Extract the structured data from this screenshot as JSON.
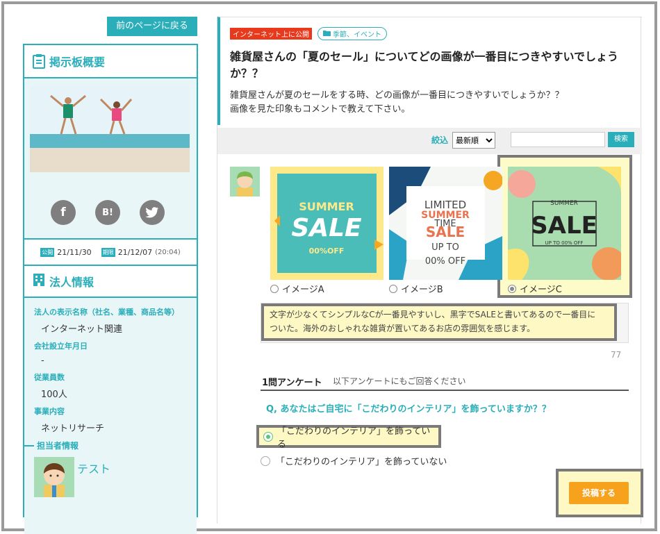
{
  "sidebar": {
    "back_button": "前のページに戻る",
    "board_title": "掲示板概要",
    "social": {
      "facebook": "f",
      "hatena": "B!",
      "twitter": "twitter"
    },
    "dates": {
      "public_tag": "公開",
      "public_date": "21/11/30",
      "deadline_tag": "期限",
      "deadline_date": "21/12/07",
      "deadline_time": "(20:04)"
    },
    "corp_title": "法人情報",
    "fields": [
      {
        "label": "法人の表示名称（社名、業種、商品名等）",
        "value": "インターネット関連"
      },
      {
        "label": "会社設立年月日",
        "value": "-"
      },
      {
        "label": "従業員数",
        "value": "100人"
      },
      {
        "label": "事業内容",
        "value": "ネットリサーチ"
      }
    ],
    "staff_title": "担当者情報",
    "staff_name": "テスト"
  },
  "post": {
    "scope_badge": "インターネット上に公開",
    "category": "季節、イベント",
    "title": "雑貨屋さんの「夏のセール」についてどの画像が一番目につきやすいでしょうか？？",
    "desc_line1": "雑貨屋さんが夏のセールをする時、どの画像が一番目につきやすいでしょうか？？",
    "desc_line2": "画像を見た印象もコメントで教えて下さい。"
  },
  "filter": {
    "label": "絞込",
    "sort_selected": "最新順",
    "search_placeholder": "",
    "search_button": "検索"
  },
  "options": [
    {
      "label": "イメージA",
      "image_text_1": "SUMMER",
      "image_text_2": "SALE",
      "image_text_3": "00%OFF",
      "selected": false
    },
    {
      "label": "イメージB",
      "image_text_1": "LIMITED",
      "image_text_2": "SUMMER",
      "image_text_3": "TIME",
      "image_text_4": "SALE",
      "image_text_5": "UP TO",
      "image_text_6": "00% OFF",
      "selected": false
    },
    {
      "label": "イメージC",
      "image_text_1": "SUMMER",
      "image_text_2": "SALE",
      "image_text_3": "UP TO 00% OFF",
      "selected": true
    }
  ],
  "comment": {
    "line1": "文字が少なくてシンプルなCが一番見やすいし、黒字でSALEと書いてあるので一番目に",
    "line2": "ついた。海外のおしゃれな雑貨が置いてあるお店の雰囲気を感じます。",
    "char_count": "77"
  },
  "survey": {
    "title": "1問アンケート",
    "subtitle": "以下アンケートにもご回答ください",
    "question": "Q, あなたはご自宅に「こだわりのインテリア」を飾っていますか？？",
    "answers": [
      {
        "label": "「こだわりのインテリア」を飾っている",
        "selected": true
      },
      {
        "label": "「こだわりのインテリア」を飾っていない",
        "selected": false
      }
    ]
  },
  "post_button": "投稿する",
  "colors": {
    "accent": "#2aaeb9",
    "orange": "#f7a21c",
    "red": "#e8391d",
    "highlight": "#fdf8c4"
  }
}
